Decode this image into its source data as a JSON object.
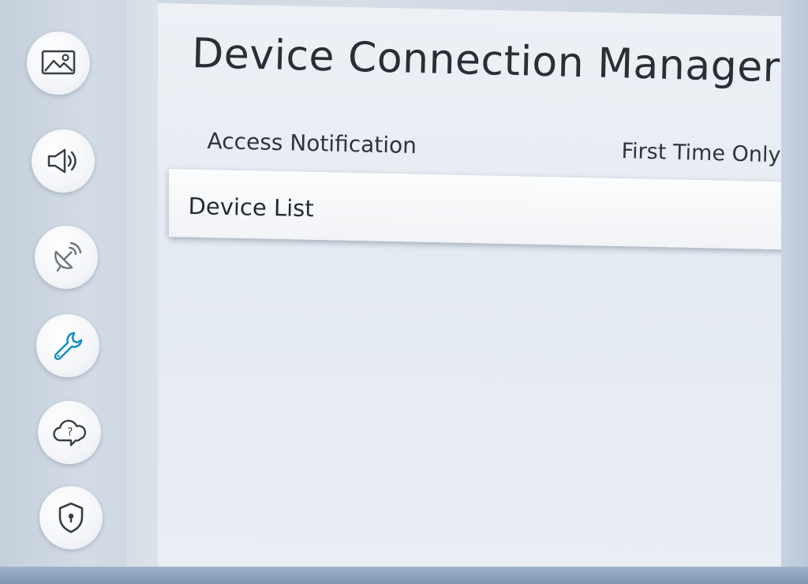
{
  "page": {
    "title": "Device Connection Manager"
  },
  "sidebar": {
    "items": [
      {
        "name": "picture",
        "icon": "picture-icon"
      },
      {
        "name": "sound",
        "icon": "speaker-icon"
      },
      {
        "name": "broadcasting",
        "icon": "satellite-icon"
      },
      {
        "name": "general",
        "icon": "wrench-icon"
      },
      {
        "name": "support",
        "icon": "help-cloud-icon"
      },
      {
        "name": "privacy",
        "icon": "shield-icon"
      }
    ],
    "active_index": 3,
    "active_color": "#1a8fc4"
  },
  "settings": {
    "access_notification": {
      "label": "Access Notification",
      "value": "First Time Only"
    },
    "device_list": {
      "label": "Device List"
    }
  }
}
